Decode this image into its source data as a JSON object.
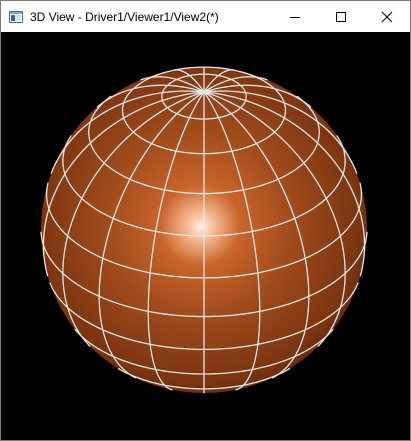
{
  "window": {
    "title": "3D View - Driver1/Viewer1/View2(*)",
    "icon": "app-window-icon",
    "controls": [
      "minimize-icon",
      "maximize-icon",
      "close-icon"
    ]
  },
  "viewport": {
    "background": "#000000",
    "object": "sphere",
    "surface_color": "#a24c1c",
    "highlight_color": "#ffe8d8",
    "wireframe_color": "#e6e6e6"
  }
}
